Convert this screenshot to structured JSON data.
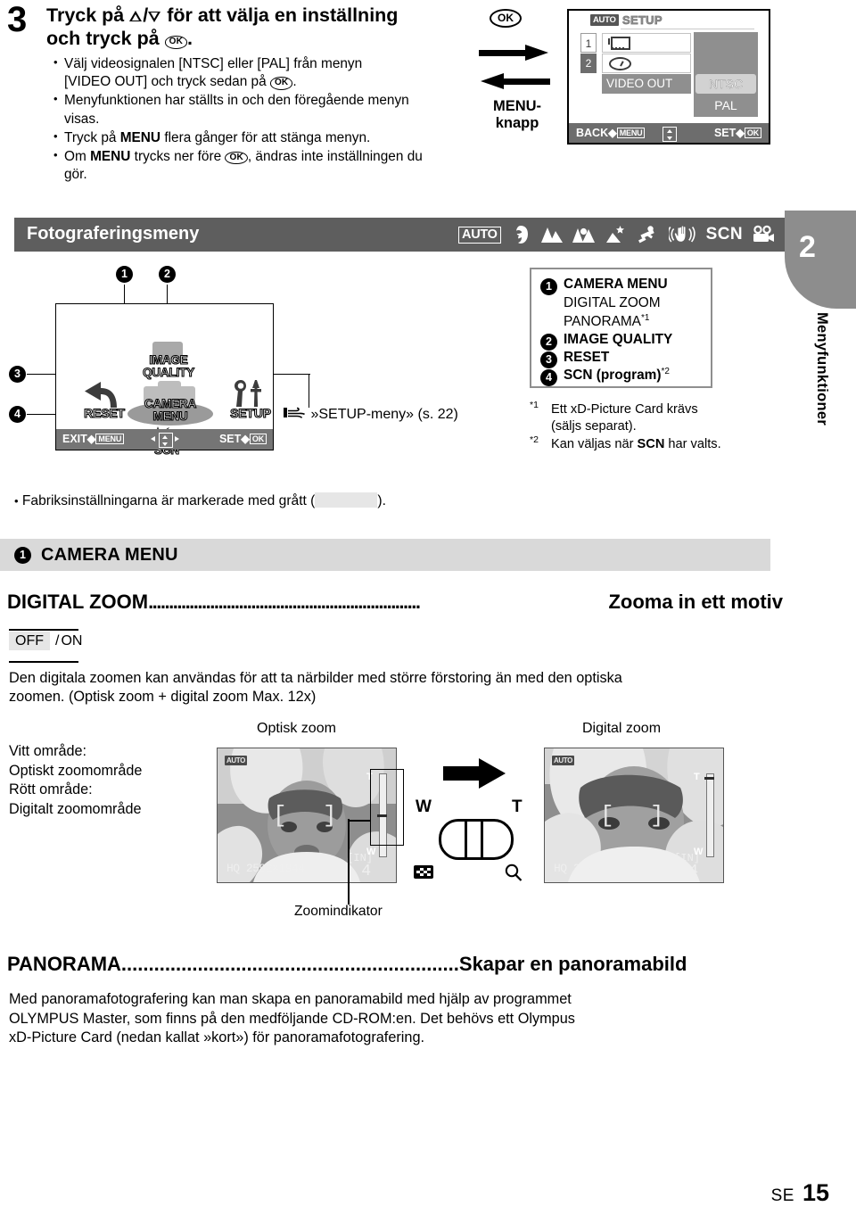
{
  "step": {
    "number": "3",
    "heading_pre": "Tryck på ",
    "heading_mid": " för att välja en inställning och tryck på ",
    "heading_post": ".",
    "ok_label": "OK",
    "bullets": [
      "Välj videosignalen [NTSC] eller [PAL] från menyn [VIDEO OUT] och tryck sedan på",
      "Menyfunktionen har ställts in och den föregående menyn visas.",
      "Tryck på MENU flera gånger för att stänga menyn.",
      "Om MENU trycks ner före , ändras inte inställningen du gör."
    ],
    "bullet1_a": "Välj videosignalen [NTSC] eller [PAL] från menyn",
    "bullet1_b": "[VIDEO OUT] och tryck sedan på",
    "bullet2": "Menyfunktionen har ställts in och den föregående menyn visas.",
    "bullet3_a": "Tryck på ",
    "bullet3_b": "MENU",
    "bullet3_c": " flera gånger för att stänga menyn.",
    "bullet4_a": "Om ",
    "bullet4_b": "MENU",
    "bullet4_c": " trycks ner före ",
    "bullet4_d": ", ändras inte inställningen du gör."
  },
  "ok_menu": {
    "ok_label": "OK",
    "menu_label_line1": "MENU-",
    "menu_label_line2": "knapp"
  },
  "lcd_setup": {
    "auto_badge": "AUTO",
    "title": "SETUP",
    "tab1": "1",
    "tab2": "2",
    "row_video_out": "VIDEO OUT",
    "option_ntsc": "NTSC",
    "option_pal": "PAL",
    "back_label": "BACK",
    "back_key": "MENU",
    "set_label": "SET",
    "set_key": "OK"
  },
  "section_bar": {
    "title": "Fotograferingsmeny",
    "mode_icons": [
      "auto-mode-icon",
      "portrait-mode-icon",
      "landscape-mode-icon",
      "landscape-portrait-mode-icon",
      "night-scene-mode-icon",
      "sport-mode-icon",
      "image-stabilizer-mode-icon",
      "scn-mode-icon",
      "movie-mode-icon"
    ],
    "auto_label": "AUTO",
    "scn_label": "SCN"
  },
  "right_tab": {
    "chapter_number": "2",
    "chapter_title": "Menyfunktioner"
  },
  "menu_map": {
    "markers": [
      "1",
      "2",
      "3",
      "4"
    ],
    "labels": {
      "image_quality_l1": "IMAGE",
      "image_quality_l2": "QUALITY",
      "camera_menu_l1": "CAMERA",
      "camera_menu_l2": "MENU",
      "reset": "RESET",
      "setup": "SETUP",
      "scn": "SCN"
    },
    "bottom": {
      "exit_label": "EXIT",
      "exit_key": "MENU",
      "set_label": "SET",
      "set_key": "OK"
    },
    "setup_ref": "»SETUP-meny» (s. 22)"
  },
  "legend": {
    "rows": [
      {
        "marker": "1",
        "text": "CAMERA MENU",
        "bold": true
      },
      {
        "marker": "",
        "text": "DIGITAL ZOOM",
        "bold": false
      },
      {
        "marker": "",
        "text": "PANORAMA",
        "sup": "*1",
        "bold": false
      },
      {
        "marker": "2",
        "text": "IMAGE QUALITY",
        "bold": true
      },
      {
        "marker": "3",
        "text": "RESET",
        "bold": true
      },
      {
        "marker": "4",
        "text": "SCN (program)",
        "sup": "*2",
        "bold": true
      }
    ],
    "footnotes": [
      {
        "mark": "*1",
        "line1": "Ett xD-Picture Card krävs",
        "line2": "(säljs separat)."
      },
      {
        "mark": "*2",
        "line1": "Kan väljas när SCN har valts.",
        "line2": ""
      }
    ],
    "footnote2_a": "Kan väljas när ",
    "footnote2_b": "SCN",
    "footnote2_c": " har valts."
  },
  "factory_note": {
    "text_before": "Fabriksinställningarna är markerade med grått (",
    "text_after": ")."
  },
  "camera_menu_header": {
    "marker": "1",
    "title": "CAMERA MENU"
  },
  "digital_zoom": {
    "title": "DIGITAL ZOOM",
    "leader": "..................................................................",
    "subtitle": "Zooma in ett motiv",
    "option_selected": "OFF",
    "option_separator": "/",
    "option_other": "ON",
    "body_line1": "Den digitala zoomen kan användas för att ta närbilder med större förstoring än med den optiska",
    "body_line2": "zoomen. (Optisk zoom + digital zoom  Max. 12x)",
    "caption_optical": "Optisk zoom",
    "caption_digital": "Digital zoom",
    "legend_line1": "Vitt område:",
    "legend_line2": "Optiskt zoomområde",
    "legend_line3": "Rött område:",
    "legend_line4": "Digitalt zoomområde",
    "zoom_indicator_caption": "Zoomindikator",
    "lever_w": "W",
    "lever_t": "T",
    "screen_auto": "AUTO",
    "screen_hq": "HQ",
    "screen_res": "2592×1944",
    "screen_in": "[IN]",
    "screen_count": "4",
    "bar_t": "T",
    "bar_w": "W"
  },
  "panorama": {
    "title": "PANORAMA",
    "leader": "..............................................................",
    "subtitle": "Skapar en panoramabild",
    "body_line1": "Med panoramafotografering kan man skapa en panoramabild med hjälp av programmet",
    "body_line2": "OLYMPUS Master, som finns på den medföljande CD-ROM:en. Det behövs ett Olympus",
    "body_line3": "xD-Picture Card (nedan kallat »kort») för panoramafotografering."
  },
  "footer": {
    "locale": "SE",
    "page_number": "15"
  },
  "colors": {
    "section_bar": "#5e5e5e",
    "tab": "#8d8d8d",
    "subheader": "#d9d9d9",
    "highlight": "#e6e6e6"
  }
}
